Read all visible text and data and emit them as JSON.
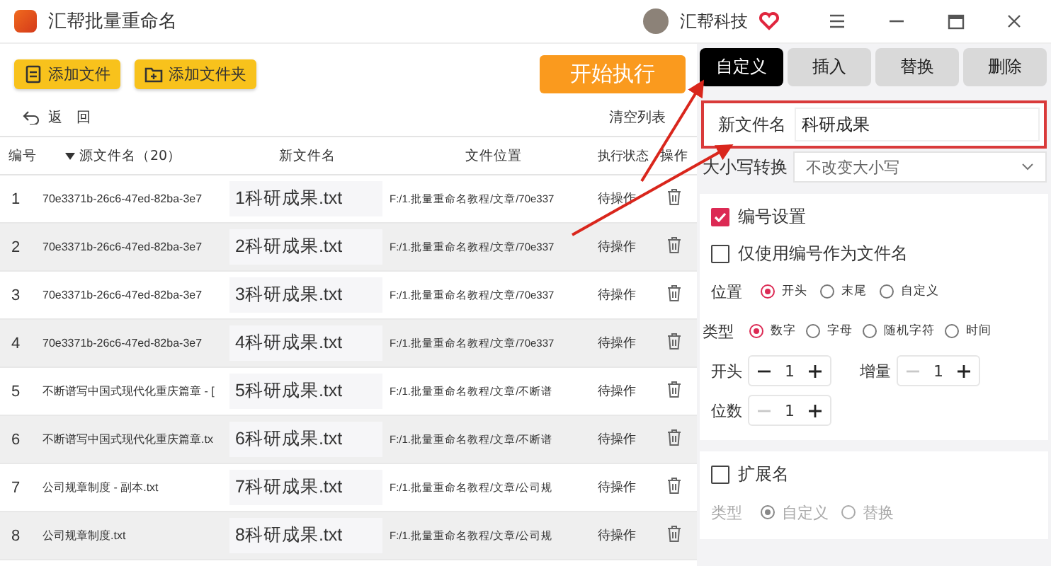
{
  "window": {
    "title": "汇帮批量重命名",
    "user": "汇帮科技"
  },
  "toolbar": {
    "buttons": [
      "添加文件",
      "添加文件夹"
    ],
    "start": "开始执行"
  },
  "undo": "返回",
  "clear_list": "清空列表",
  "table": {
    "columns": [
      "编号",
      "源文件名（20）",
      "新文件名",
      "文件位置",
      "执行状态",
      "操作"
    ],
    "rows": [
      {
        "no": "1",
        "source": "70e3371b-26c6-47ed-82ba-3e7",
        "new": "1科研成果.txt",
        "path": "F:/1.批量重命名教程/文章/70e337",
        "status": "待操作"
      },
      {
        "no": "2",
        "source": "70e3371b-26c6-47ed-82ba-3e7",
        "new": "2科研成果.txt",
        "path": "F:/1.批量重命名教程/文章/70e337",
        "status": "待操作"
      },
      {
        "no": "3",
        "source": "70e3371b-26c6-47ed-82ba-3e7",
        "new": "3科研成果.txt",
        "path": "F:/1.批量重命名教程/文章/70e337",
        "status": "待操作"
      },
      {
        "no": "4",
        "source": "70e3371b-26c6-47ed-82ba-3e7",
        "new": "4科研成果.txt",
        "path": "F:/1.批量重命名教程/文章/70e337",
        "status": "待操作"
      },
      {
        "no": "5",
        "source": "不断谱写中国式现代化重庆篇章 - [",
        "new": "5科研成果.txt",
        "path": "F:/1.批量重命名教程/文章/不断谱",
        "status": "待操作"
      },
      {
        "no": "6",
        "source": "不断谱写中国式现代化重庆篇章.tx",
        "new": "6科研成果.txt",
        "path": "F:/1.批量重命名教程/文章/不断谱",
        "status": "待操作"
      },
      {
        "no": "7",
        "source": "公司规章制度 - 副本.txt",
        "new": "7科研成果.txt",
        "path": "F:/1.批量重命名教程/文章/公司规",
        "status": "待操作"
      },
      {
        "no": "8",
        "source": "公司规章制度.txt",
        "new": "8科研成果.txt",
        "path": "F:/1.批量重命名教程/文章/公司规",
        "status": "待操作"
      }
    ]
  },
  "tabs": [
    {
      "label": "自定义",
      "selected": true
    },
    {
      "label": "插入",
      "selected": false
    },
    {
      "label": "替换",
      "selected": false
    },
    {
      "label": "删除",
      "selected": false
    }
  ],
  "new_name": {
    "label": "新文件名",
    "value": "科研成果"
  },
  "case": {
    "label": "大小写转换",
    "value": "不改变大小写"
  },
  "numbering": {
    "label": "编号设置",
    "checked": true,
    "only_number": {
      "label": "仅使用编号作为文件名",
      "checked": false
    },
    "position": {
      "label": "位置",
      "options": [
        {
          "label": "开头",
          "selected": true
        },
        {
          "label": "末尾",
          "selected": false
        },
        {
          "label": "自定义",
          "selected": false
        }
      ]
    },
    "type": {
      "label": "类型",
      "options": [
        {
          "label": "数字",
          "selected": true
        },
        {
          "label": "字母",
          "selected": false
        },
        {
          "label": "随机字符",
          "selected": false
        },
        {
          "label": "时间",
          "selected": false
        }
      ]
    },
    "steppers": [
      {
        "label": "开头",
        "value": "1",
        "minus_disabled": false
      },
      {
        "label": "增量",
        "value": "1",
        "minus_disabled": true
      },
      {
        "label": "位数",
        "value": "1",
        "minus_disabled": true
      }
    ]
  },
  "extension": {
    "label": "扩展名",
    "checked": false,
    "type": {
      "label": "类型",
      "disabled": true,
      "options": [
        {
          "label": "自定义",
          "selected": true
        },
        {
          "label": "替换",
          "selected": false
        }
      ]
    }
  }
}
